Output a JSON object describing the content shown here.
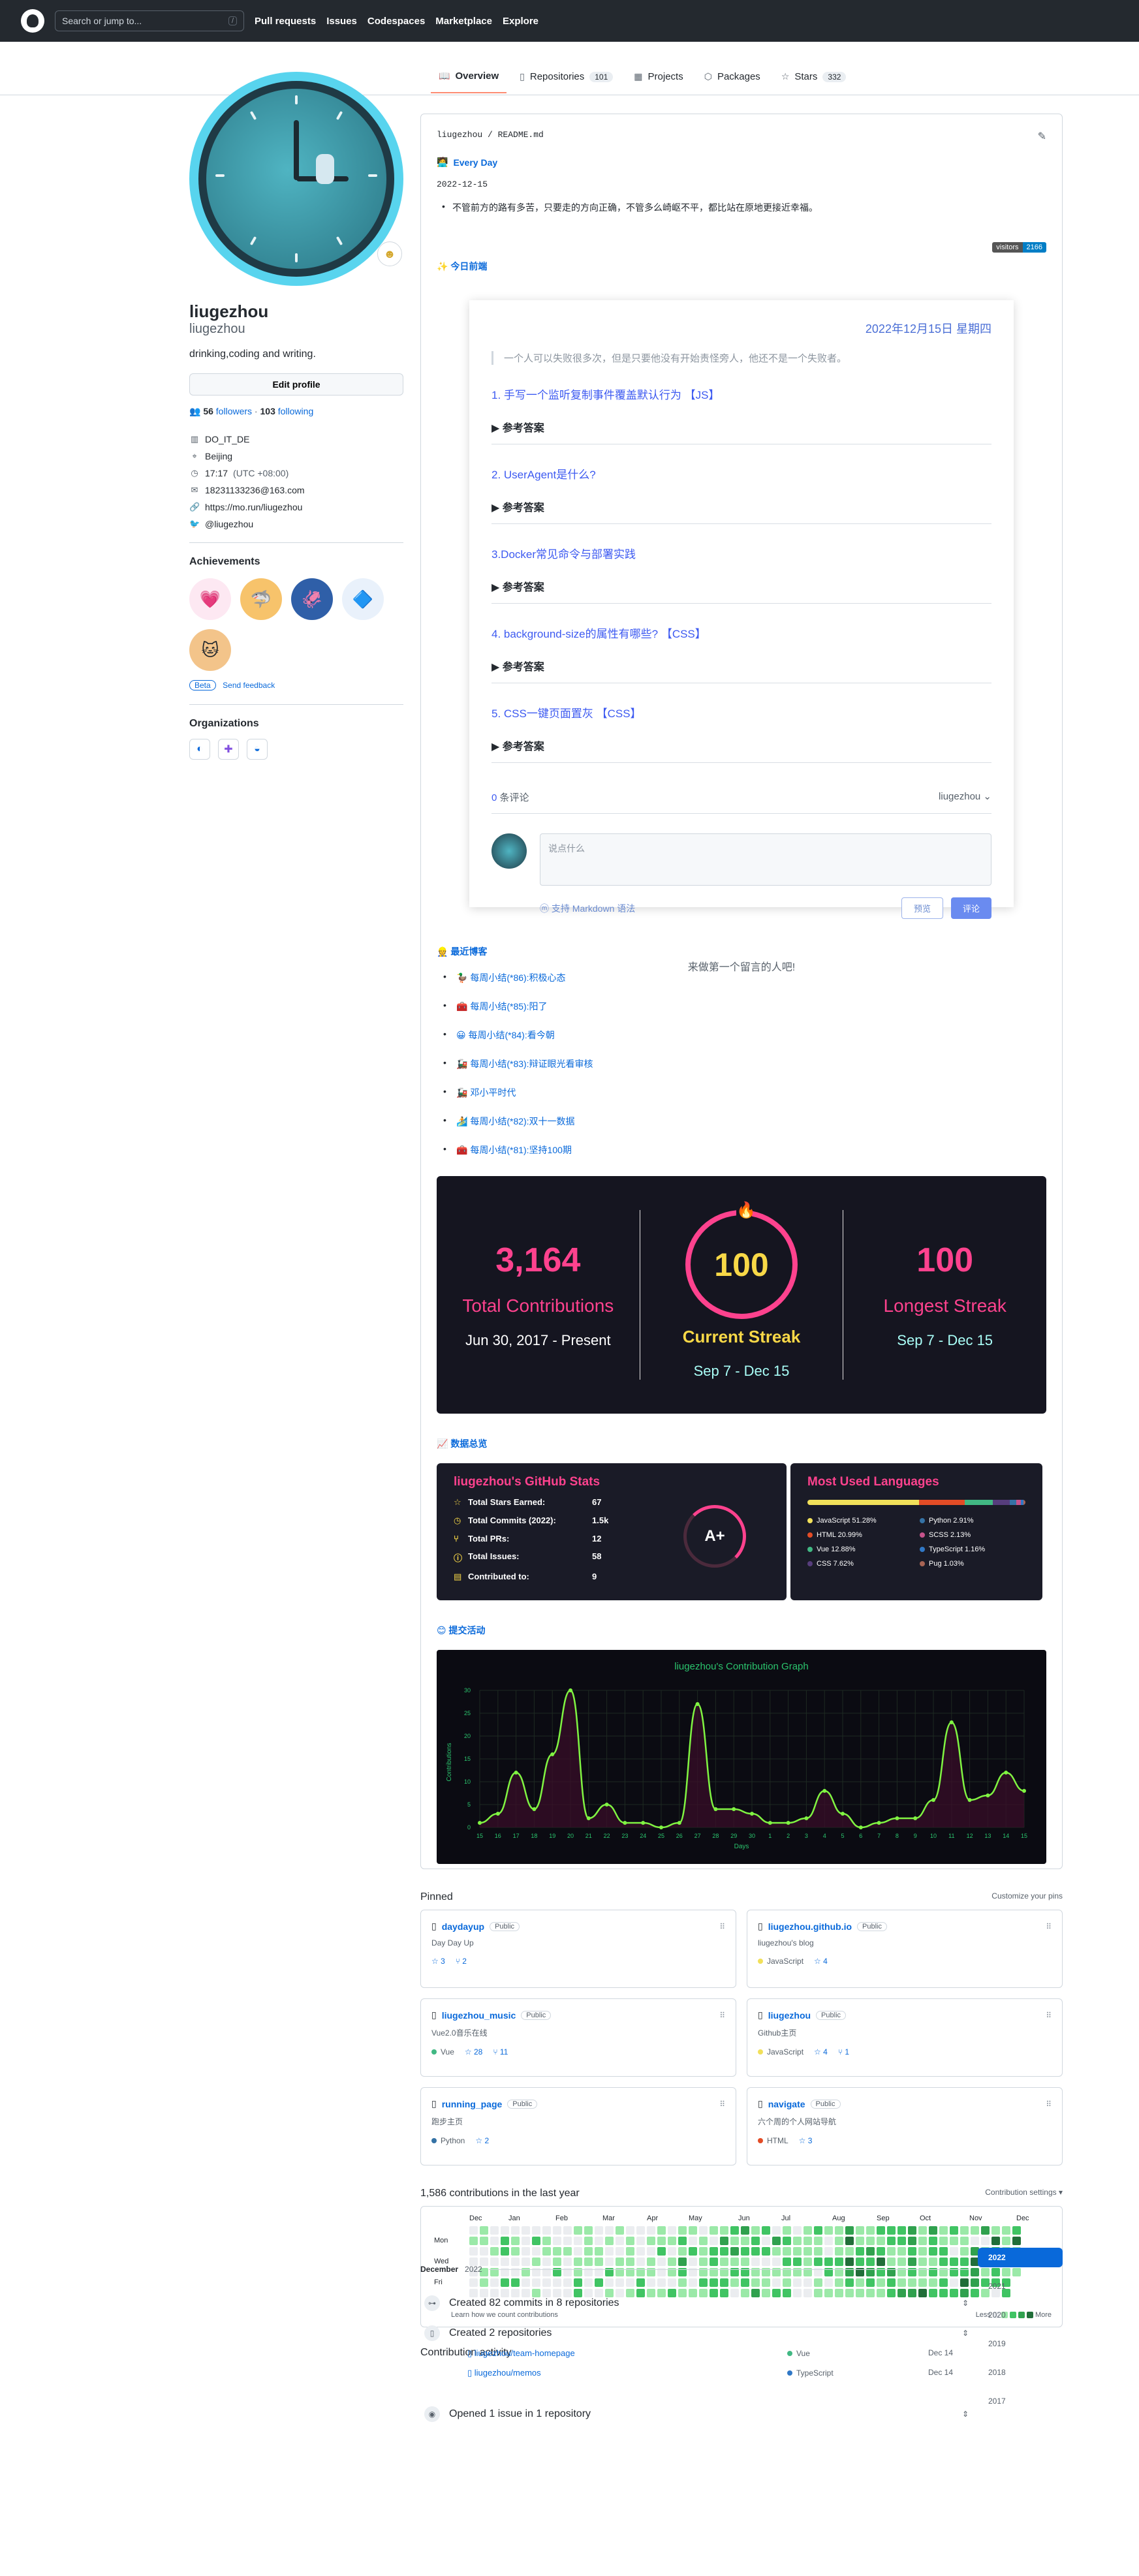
{
  "header": {
    "search_placeholder": "Search or jump to...",
    "search_kbd": "/",
    "nav": [
      "Pull requests",
      "Issues",
      "Codespaces",
      "Marketplace",
      "Explore"
    ]
  },
  "tabs": {
    "overview": "Overview",
    "repositories": "Repositories",
    "repositories_count": "101",
    "projects": "Projects",
    "packages": "Packages",
    "stars": "Stars",
    "stars_count": "332"
  },
  "profile": {
    "display_name": "liugezhou",
    "username": "liugezhou",
    "bio": "drinking,coding and writing.",
    "edit_label": "Edit profile",
    "followers": "56",
    "followers_label": "followers",
    "following": "103",
    "following_label": "following",
    "company": "DO_IT_DE",
    "location": "Beijing",
    "time": "17:17",
    "timezone": "(UTC +08:00)",
    "email": "18231133236@163.com",
    "website": "https://mo.run/liugezhou",
    "twitter": "@liugezhou"
  },
  "achievements": {
    "title": "Achievements",
    "beta": "Beta",
    "feedback": "Send feedback"
  },
  "organizations": {
    "title": "Organizations"
  },
  "readme": {
    "path": "liugezhou / README.md",
    "every_day": "Every Day",
    "date": "2022-12-15",
    "quote": "不管前方的路有多苦，只要走的方向正确，不管多么崎岖不平，都比站在原地更接近幸福。",
    "visitors_label": "visitors",
    "visitors_count": "2166",
    "today_frontend": "今日前端",
    "daily": {
      "date": "2022年12月15日 星期四",
      "quote": "一个人可以失败很多次，但是只要他没有开始责怪旁人，他还不是一个失败者。",
      "questions": [
        {
          "q": "1. 手写一个监听复制事件覆盖默认行为 【JS】",
          "a": "参考答案"
        },
        {
          "q": "2. UserAgent是什么?",
          "a": "参考答案"
        },
        {
          "q": "3.Docker常见命令与部署实践",
          "a": "参考答案"
        },
        {
          "q": "4. background-size的属性有哪些? 【CSS】",
          "a": "参考答案"
        },
        {
          "q": "5. CSS一键页面置灰 【CSS】",
          "a": "参考答案"
        }
      ],
      "comment_count": "0",
      "comment_label": "条评论",
      "user": "liugezhou",
      "placeholder": "说点什么",
      "markdown": "支持 Markdown 语法",
      "preview": "预览",
      "submit": "评论",
      "empty": "来做第一个留言的人吧!"
    },
    "blogs_title": "最近博客",
    "blogs": [
      "每周小结(*86):积极心态",
      "每周小结(*85):阳了",
      "每周小结(*84):看今朝",
      "每周小结(*83):辩证眼光看审核",
      "邓小平时代",
      "每周小结(*82):双十一数据",
      "每周小结(*81):坚持100期"
    ],
    "streak": {
      "total": "3,164",
      "total_label": "Total Contributions",
      "total_range": "Jun 30, 2017 - Present",
      "current": "100",
      "current_label": "Current Streak",
      "current_range": "Sep 7 - Dec 15",
      "longest": "100",
      "longest_label": "Longest Streak",
      "longest_range": "Sep 7 - Dec 15"
    },
    "stats_title_section": "数据总览",
    "stats": {
      "title": "liugezhou's GitHub Stats",
      "rows": [
        {
          "label": "Total Stars Earned:",
          "value": "67"
        },
        {
          "label": "Total Commits (2022):",
          "value": "1.5k"
        },
        {
          "label": "Total PRs:",
          "value": "12"
        },
        {
          "label": "Total Issues:",
          "value": "58"
        },
        {
          "label": "Contributed to:",
          "value": "9"
        }
      ],
      "grade": "A+"
    },
    "languages": {
      "title": "Most Used Languages",
      "items": [
        {
          "name": "JavaScript 51.28%",
          "pct": 51.28,
          "color": "#f1e05a"
        },
        {
          "name": "Python 2.91%",
          "pct": 2.91,
          "color": "#3572a5"
        },
        {
          "name": "HTML 20.99%",
          "pct": 20.99,
          "color": "#e34c26"
        },
        {
          "name": "SCSS 2.13%",
          "pct": 2.13,
          "color": "#c6538c"
        },
        {
          "name": "Vue 12.88%",
          "pct": 12.88,
          "color": "#41b883"
        },
        {
          "name": "TypeScript 1.16%",
          "pct": 1.16,
          "color": "#3178c6"
        },
        {
          "name": "CSS 7.62%",
          "pct": 7.62,
          "color": "#563d7c"
        },
        {
          "name": "Pug 1.03%",
          "pct": 1.03,
          "color": "#a86454"
        }
      ]
    },
    "activity_title": "提交活动"
  },
  "chart_data": {
    "type": "line",
    "title": "liugezhou's Contribution Graph",
    "xlabel": "Days",
    "ylabel": "Contributions",
    "ylim": [
      0,
      30
    ],
    "yticks": [
      0,
      5,
      10,
      15,
      20,
      25,
      30
    ],
    "x": [
      "15",
      "16",
      "17",
      "18",
      "19",
      "20",
      "21",
      "22",
      "23",
      "24",
      "25",
      "26",
      "27",
      "28",
      "29",
      "30",
      "1",
      "2",
      "3",
      "4",
      "5",
      "6",
      "7",
      "8",
      "9",
      "10",
      "11",
      "12",
      "13",
      "14",
      "15"
    ],
    "values": [
      1,
      3,
      12,
      4,
      16,
      30,
      2,
      5,
      1,
      1,
      0,
      1,
      27,
      4,
      4,
      3,
      1,
      1,
      2,
      8,
      3,
      0,
      1,
      2,
      2,
      6,
      23,
      6,
      7,
      12,
      8
    ],
    "line_color": "#80f442"
  },
  "pinned": {
    "title": "Pinned",
    "customize": "Customize your pins",
    "public_label": "Public",
    "repos": [
      {
        "name": "daydayup",
        "desc": "Day Day Up",
        "lang": "",
        "lang_color": "",
        "stars": "3",
        "forks": "2"
      },
      {
        "name": "liugezhou.github.io",
        "desc": "liugezhou's blog",
        "lang": "JavaScript",
        "lang_color": "#f1e05a",
        "stars": "4",
        "forks": ""
      },
      {
        "name": "liugezhou_music",
        "desc": "Vue2.0音乐在线",
        "lang": "Vue",
        "lang_color": "#41b883",
        "stars": "28",
        "forks": "11"
      },
      {
        "name": "liugezhou",
        "desc": "Github主页",
        "lang": "JavaScript",
        "lang_color": "#f1e05a",
        "stars": "4",
        "forks": "1"
      },
      {
        "name": "running_page",
        "desc": "跑步主页",
        "lang": "Python",
        "lang_color": "#3572a5",
        "stars": "2",
        "forks": ""
      },
      {
        "name": "navigate",
        "desc": "六个周的个人网站导航",
        "lang": "HTML",
        "lang_color": "#e34c26",
        "stars": "3",
        "forks": ""
      }
    ]
  },
  "contributions": {
    "summary": "1,586 contributions in the last year",
    "settings": "Contribution settings",
    "months": [
      "Dec",
      "Jan",
      "Feb",
      "Mar",
      "Apr",
      "May",
      "Jun",
      "Jul",
      "Aug",
      "Sep",
      "Oct",
      "Nov",
      "Dec"
    ],
    "days": [
      "Mon",
      "Wed",
      "Fri"
    ],
    "learn": "Learn how we count contributions",
    "less": "Less",
    "more": "More"
  },
  "activity": {
    "title": "Contribution activity",
    "month": "December",
    "year": "2022",
    "years": [
      "2022",
      "2021",
      "2020",
      "2019",
      "2018",
      "2017"
    ],
    "commits": "Created 82 commits in 8 repositories",
    "repos_created": "Created 2 repositories",
    "new_repos": [
      {
        "name": "liugezhou/team-homepage",
        "lang": "Vue",
        "lang_color": "#41b883",
        "date": "Dec 14"
      },
      {
        "name": "liugezhou/memos",
        "lang": "TypeScript",
        "lang_color": "#3178c6",
        "date": "Dec 14"
      }
    ],
    "issues": "Opened 1 issue in 1 repository"
  }
}
